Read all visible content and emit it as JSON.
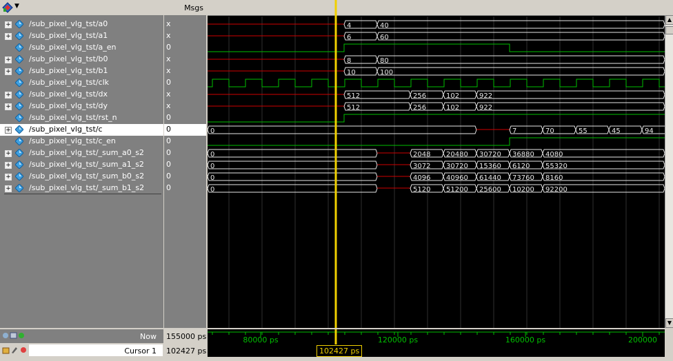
{
  "header": {
    "msgs_label": "Msgs"
  },
  "signals": [
    {
      "name": "/sub_pixel_vlg_tst/a0",
      "value": "x",
      "expandable": true,
      "selected": false
    },
    {
      "name": "/sub_pixel_vlg_tst/a1",
      "value": "x",
      "expandable": true,
      "selected": false
    },
    {
      "name": "/sub_pixel_vlg_tst/a_en",
      "value": "0",
      "expandable": false,
      "selected": false
    },
    {
      "name": "/sub_pixel_vlg_tst/b0",
      "value": "x",
      "expandable": true,
      "selected": false
    },
    {
      "name": "/sub_pixel_vlg_tst/b1",
      "value": "x",
      "expandable": true,
      "selected": false
    },
    {
      "name": "/sub_pixel_vlg_tst/clk",
      "value": "0",
      "expandable": false,
      "selected": false
    },
    {
      "name": "/sub_pixel_vlg_tst/dx",
      "value": "x",
      "expandable": true,
      "selected": false
    },
    {
      "name": "/sub_pixel_vlg_tst/dy",
      "value": "x",
      "expandable": true,
      "selected": false
    },
    {
      "name": "/sub_pixel_vlg_tst/rst_n",
      "value": "0",
      "expandable": false,
      "selected": false
    },
    {
      "name": "/sub_pixel_vlg_tst/c",
      "value": "0",
      "expandable": true,
      "selected": true
    },
    {
      "name": "/sub_pixel_vlg_tst/c_en",
      "value": "0",
      "expandable": false,
      "selected": false
    },
    {
      "name": "/sub_pixel_vlg_tst/_sum_a0_s2",
      "value": "0",
      "expandable": true,
      "selected": false
    },
    {
      "name": "/sub_pixel_vlg_tst/_sum_a1_s2",
      "value": "0",
      "expandable": true,
      "selected": false
    },
    {
      "name": "/sub_pixel_vlg_tst/_sum_b0_s2",
      "value": "0",
      "expandable": true,
      "selected": false
    },
    {
      "name": "/sub_pixel_vlg_tst/_sum_b1_s2",
      "value": "0",
      "expandable": true,
      "selected": false
    }
  ],
  "waves": {
    "a0": [
      "4",
      "40"
    ],
    "a1": [
      "6",
      "60"
    ],
    "b0": [
      "8",
      "80"
    ],
    "b1": [
      "10",
      "100"
    ],
    "dx": [
      "512",
      "256",
      "102",
      "922"
    ],
    "dy": [
      "512",
      "256",
      "102",
      "922"
    ],
    "c": [
      "0",
      "7",
      "70",
      "55",
      "45",
      "94"
    ],
    "sum_a0_s2": [
      "0",
      "2048",
      "20480",
      "30720",
      "36880",
      "4080"
    ],
    "sum_a1_s2": [
      "0",
      "3072",
      "30720",
      "15360",
      "6120",
      "55320"
    ],
    "sum_b0_s2": [
      "0",
      "4096",
      "40960",
      "61440",
      "73760",
      "8160"
    ],
    "sum_b1_s2": [
      "0",
      "5120",
      "51200",
      "25600",
      "10200",
      "92200"
    ]
  },
  "status": {
    "now_label": "Now",
    "now_value": "155000 ps",
    "cursor_label": "Cursor 1",
    "cursor_value": "102427 ps",
    "cursor_marker": "102427 ps"
  },
  "timeline": {
    "ticks": [
      "80000 ps",
      "120000 ps",
      "160000 ps",
      "200000"
    ]
  },
  "colors": {
    "wave_bus": "#e8e8e8",
    "wave_logic": "#00c000",
    "wave_unknown": "#d00000",
    "cursor": "#f0d000",
    "ruler": "#00c000"
  }
}
